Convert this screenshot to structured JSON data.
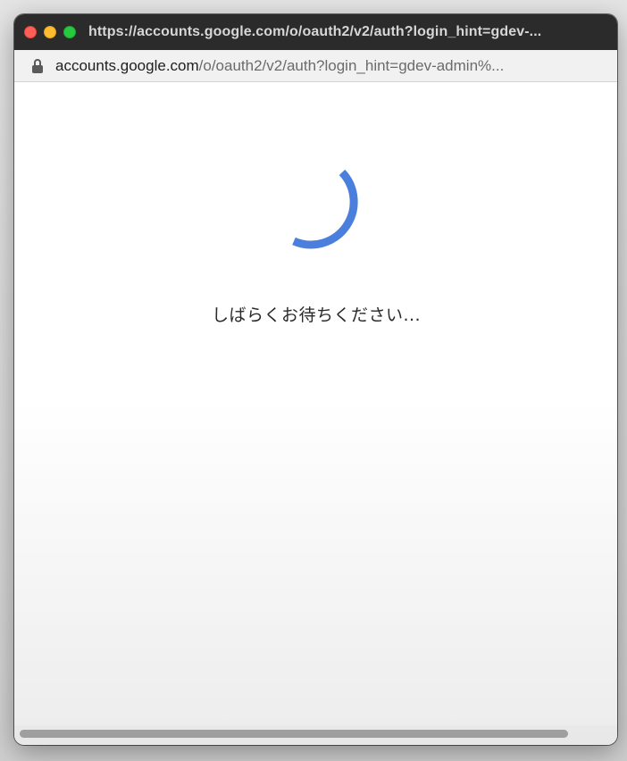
{
  "window": {
    "title": "https://accounts.google.com/o/oauth2/v2/auth?login_hint=gdev-..."
  },
  "address_bar": {
    "host": "accounts.google.com",
    "path": "/o/oauth2/v2/auth?login_hint=gdev-admin%..."
  },
  "content": {
    "loading_message": "しばらくお待ちください..."
  },
  "colors": {
    "spinner": "#4a7fde",
    "titlebar": "#2b2b2b",
    "close_light": "#fe5f57",
    "minimize_light": "#febc2e",
    "maximize_light": "#28c840"
  },
  "icons": {
    "lock": "lock-icon",
    "spinner": "loading-spinner"
  }
}
